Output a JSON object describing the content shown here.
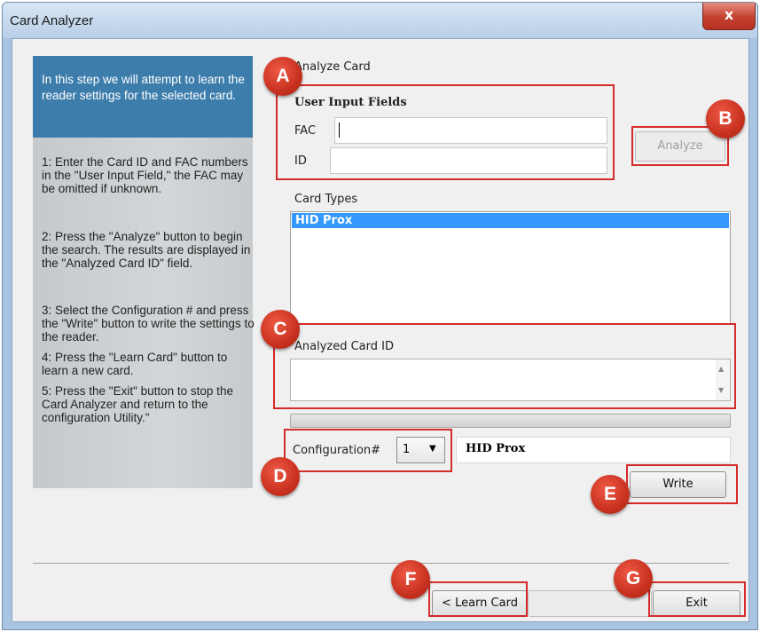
{
  "window": {
    "title": "Card Analyzer",
    "close_label": "x"
  },
  "sidebar": {
    "intro": "In this step we will attempt to learn the reader settings for the selected card.",
    "steps": [
      "1: Enter the Card ID and FAC numbers in the \"User Input Field,\" the FAC may be omitted if unknown.",
      "2: Press the \"Analyze\" button to begin the search. The results are displayed in the \"Analyzed Card ID\" field.",
      "3: Select the Configuration # and press the \"Write\" button to write the settings to the reader.",
      "4: Press the \"Learn Card\" button to learn a new card.",
      "5: Press the \"Exit\" button to stop the Card Analyzer and return to the configuration Utility.\""
    ]
  },
  "analyze_group": {
    "title": "Analyze Card",
    "user_input_title": "User Input Fields",
    "fac_label": "FAC",
    "fac_value": "",
    "id_label": "ID",
    "id_value": "",
    "analyze_button": "Analyze"
  },
  "card_types": {
    "label": "Card Types",
    "items": [
      "HID Prox"
    ],
    "selected": "HID Prox"
  },
  "analyzed": {
    "label": "Analyzed Card ID",
    "value": ""
  },
  "configuration": {
    "label": "Configuration#",
    "selected": "1",
    "card_name": "HID Prox",
    "write_button": "Write"
  },
  "footer": {
    "learn_button": "< Learn Card",
    "exit_button": "Exit"
  },
  "markers": [
    "A",
    "B",
    "C",
    "D",
    "E",
    "F",
    "G"
  ],
  "colors": {
    "marker": "#c8311f",
    "highlight_box": "#d42b2b",
    "sidebar_header": "#3d7dab",
    "selection": "#3399ff"
  }
}
